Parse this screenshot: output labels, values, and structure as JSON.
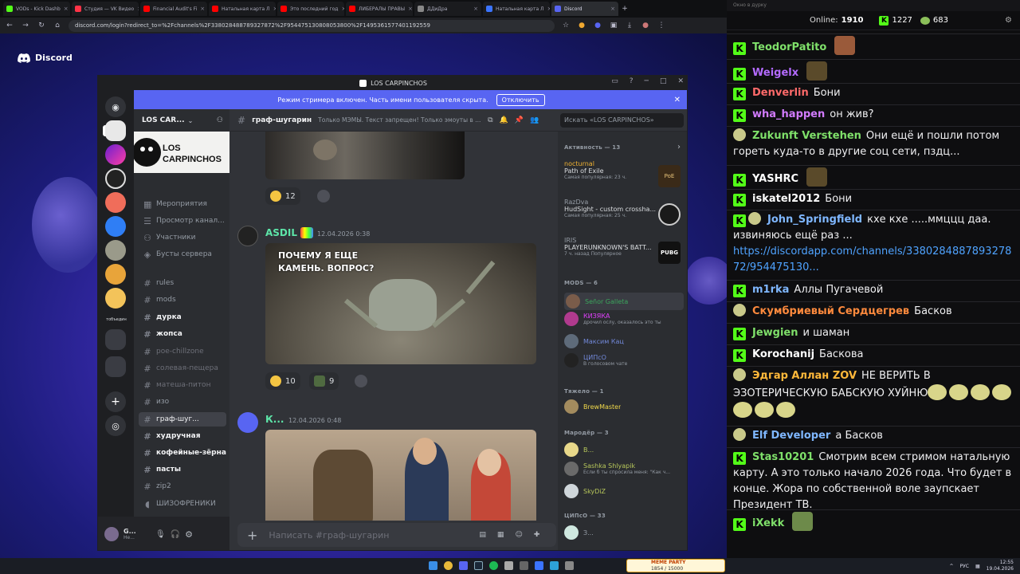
{
  "browser": {
    "tabs": [
      {
        "label": "VODs - Kick Dashb",
        "color": "#53fc18",
        "active": false
      },
      {
        "label": "Студия — VK Видео",
        "color": "#ff3347",
        "active": false
      },
      {
        "label": "Financial Audit's Fi",
        "color": "#ff0000",
        "active": false
      },
      {
        "label": "Натальная карта Л",
        "color": "#ff0000",
        "active": false
      },
      {
        "label": "Это последний год",
        "color": "#ff0000",
        "active": false
      },
      {
        "label": "ЛИБЕРАЛЫ ПРАВЫ",
        "color": "#ff0000",
        "active": false
      },
      {
        "label": "ДДиДра",
        "color": "#888888",
        "active": false
      },
      {
        "label": "Натальная карта Л",
        "color": "#3b74ff",
        "active": false
      },
      {
        "label": "Discord",
        "color": "#5865f2",
        "active": true
      }
    ],
    "url": "discord.com/login?redirect_to=%2Fchannels%2F338028488789327872%2F954475130808053800%2F1495361577401192559"
  },
  "discord": {
    "brand": "Discord",
    "window_title": "LOS CARPINCHOS",
    "banner_text": "Режим стримера включен. Часть имени пользователя скрыта.",
    "banner_button": "Отключить",
    "server_name": "LOS CAR...",
    "server_logo_text": "LOS\nCARPINCHOS",
    "guild_folder_label": "тобъедин",
    "channels": [
      {
        "label": "Мероприятия",
        "icon": "calendar-icon",
        "style": "normal"
      },
      {
        "label": "Просмотр канал...",
        "icon": "browse-icon",
        "style": "normal"
      },
      {
        "label": "Участники",
        "icon": "members-icon",
        "style": "normal"
      },
      {
        "label": "Бусты сервера",
        "icon": "boost-icon",
        "style": "normal"
      },
      {
        "label": "rules",
        "icon": "#",
        "style": "normal"
      },
      {
        "label": "mods",
        "icon": "#",
        "style": "normal"
      },
      {
        "label": "дурка",
        "icon": "#",
        "style": "bold"
      },
      {
        "label": "жопса",
        "icon": "#",
        "style": "bold"
      },
      {
        "label": "poe-chillzone",
        "icon": "#",
        "style": "dim"
      },
      {
        "label": "солевая-пещера",
        "icon": "#",
        "style": "dim"
      },
      {
        "label": "матеша-питон",
        "icon": "#",
        "style": "dim"
      },
      {
        "label": "изо",
        "icon": "#",
        "style": "normal"
      },
      {
        "label": "граф-шуг...",
        "icon": "#",
        "style": "selected"
      },
      {
        "label": "худручная",
        "icon": "#",
        "style": "bold"
      },
      {
        "label": "кофейные-зёрна",
        "icon": "#",
        "style": "bold"
      },
      {
        "label": "пасты",
        "icon": "#",
        "style": "bold"
      },
      {
        "label": "zip2",
        "icon": "#",
        "style": "normal"
      },
      {
        "label": "ШИЗОФРЕНИКИ",
        "icon": "speaker-icon",
        "style": "normal"
      },
      {
        "label": "FREE 1",
        "icon": "speaker-icon",
        "style": "normal"
      }
    ],
    "user": {
      "name": "G...",
      "status": "Не..."
    },
    "channel_header": {
      "name": "граф-шугарин",
      "topic": "Только МЭМЫ. Текст запрещен! Только эмоуты в ...",
      "search_placeholder": "Искать «LOS CARPINCHOS»"
    },
    "messages": [
      {
        "reactions": [
          {
            "emoji": "rofl",
            "count": "12"
          }
        ]
      },
      {
        "author": "ASDIL",
        "timestamp": "12.04.2026 0:38",
        "image_caption": "ПОЧЕМУ Я ЕЩЕ\nКАМЕНЬ. ВОПРОС?",
        "reactions": [
          {
            "emoji": "thinking",
            "count": "10"
          },
          {
            "emoji": "custom-pepe",
            "count": "9"
          }
        ]
      },
      {
        "author": "К...",
        "timestamp": "12.04.2026 0:48"
      }
    ],
    "composer_placeholder": "Написать #граф-шугарин",
    "members": {
      "activity_header": "Активность — 13",
      "activities": [
        {
          "user": "nocturnal",
          "game": "Path of Exile",
          "sub": "Самая популярная: 23 ч.",
          "badge": "PoE"
        },
        {
          "user": "RazDva",
          "game": "HudSight - custom crossha...",
          "sub": "Самая популярная: 25 ч."
        },
        {
          "user": "IRIS",
          "game": "PLAYERUNKNOWN'S BATT...",
          "sub": "7 ч. назад   Популярное",
          "badge": "PUBG"
        }
      ],
      "mods_header": "MODS — 6",
      "mods": [
        {
          "name": "Señor Galleta",
          "sub": "",
          "color": "#3ba55c"
        },
        {
          "name": "КИЗЯКА",
          "sub": "дрочил ослу, оказалось это ты",
          "color": "#e040fb"
        },
        {
          "name": "Максим Кац",
          "sub": "",
          "color": "#7289da"
        },
        {
          "name": "ЦИПсО",
          "sub": "В голосовом чате",
          "color": "#7289da"
        }
      ],
      "heavy_header": "Тяжело — 1",
      "heavy": [
        {
          "name": "BrewMaster",
          "sub": ""
        }
      ],
      "marauder_header": "Мародёр — 3",
      "marauder": [
        {
          "name": "В...",
          "sub": ""
        },
        {
          "name": "Sashka Shlyapik",
          "sub": "Если б ты спросила меня: \"Как ч..."
        },
        {
          "name": "SkyDiZ",
          "sub": ""
        }
      ],
      "cips_header": "ЦИПсО — 33",
      "cips": [
        {
          "name": "З...",
          "sub": ""
        }
      ]
    }
  },
  "stream": {
    "window_title": "Окно в дурку",
    "online_label": "Online:",
    "online_count": "1910",
    "kick_count": "1227",
    "viewer_count": "683",
    "messages": [
      {
        "platform": "kick",
        "user": "TeodorPatito",
        "color": "#7fe06a",
        "text": "",
        "emote": true
      },
      {
        "platform": "kick",
        "user": "Weigelx",
        "color": "#b46bff",
        "text": "",
        "emote": true
      },
      {
        "platform": "kick",
        "user": "Denverlin",
        "color": "#ff6a6a",
        "text": "Бони"
      },
      {
        "platform": "kick",
        "user": "wha_happen",
        "color": "#d27bff",
        "text": "он жив?"
      },
      {
        "platform": "badge",
        "user": "Zukunft Verstehen",
        "color": "#7fe06a",
        "text": "Они ещё и пошли потом гореть куда-то в другие соц сети, пздц..."
      },
      {
        "platform": "kick",
        "user": "YASHRC",
        "color": "#ffffff",
        "text": "",
        "emote": true
      },
      {
        "platform": "kick",
        "user": "iskatel2012",
        "color": "#ffffff",
        "text": "Бони"
      },
      {
        "platform": "dual",
        "user": "John_Springfield",
        "color": "#7fb7ff",
        "text": "кхе кхе .....ммццц даа. извиняюсь ещё раз ...",
        "link": "https://discordapp.com/channels/338028488789327872/954475130..."
      },
      {
        "platform": "kick",
        "user": "m1rka",
        "color": "#7fb7ff",
        "text": "Аллы Пугачевой"
      },
      {
        "platform": "badge",
        "user": "Скумбриевый Сердцегрев",
        "color": "#ff8a3d",
        "text": "Басков"
      },
      {
        "platform": "kick",
        "user": "Jewgien",
        "color": "#7fe06a",
        "text": "и шаман"
      },
      {
        "platform": "kick",
        "user": "Korochanij",
        "color": "#ffffff",
        "text": "Баскова"
      },
      {
        "platform": "badge",
        "user": "Эдгар Аллан ZOV",
        "color": "#ffb83a",
        "text": "НЕ ВЕРИТЬ В ЭЗОТЕРИЧЕСКУЮ БАБСКУЮ ХУЙНЮ"
      },
      {
        "platform": "badge",
        "user": "Elf Developer",
        "color": "#7fb7ff",
        "text": "а Басков"
      },
      {
        "platform": "kick",
        "user": "Stas10201",
        "color": "#7fe06a",
        "text": "Смотрим всем стримом натальную карту. А это только начало 2026 года. Что будет в конце. Жора по собственной воле заупскает Президент ТВ."
      },
      {
        "platform": "kick",
        "user": "iXekk",
        "color": "#7fe06a",
        "text": "",
        "emote": true
      }
    ]
  },
  "taskbar": {
    "lang": "РУС",
    "time": "12:55",
    "date": "19.04.2026",
    "widget_label": "MEME PARTY",
    "widget_value": "1854 / 15000"
  }
}
